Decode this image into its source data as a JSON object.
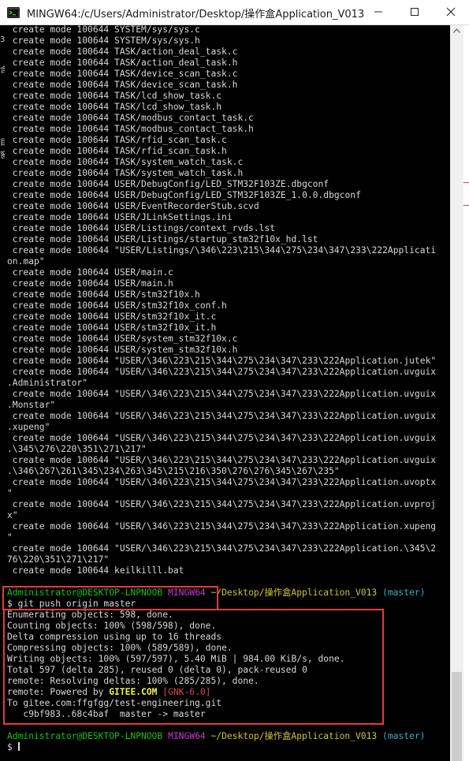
{
  "window": {
    "title": "MINGW64:/c/Users/Administrator/Desktop/操作盒Application_V013",
    "controls": [
      "minimize",
      "maximize",
      "close"
    ]
  },
  "terminal": {
    "lines": [
      " create mode 100644 SYSTEM/sys/sys.c",
      " create mode 100644 SYSTEM/sys/sys.h",
      " create mode 100644 TASK/action_deal_task.c",
      " create mode 100644 TASK/action_deal_task.h",
      " create mode 100644 TASK/device_scan_task.c",
      " create mode 100644 TASK/device_scan_task.h",
      " create mode 100644 TASK/lcd_show_task.c",
      " create mode 100644 TASK/lcd_show_task.h",
      " create mode 100644 TASK/modbus_contact_task.c",
      " create mode 100644 TASK/modbus_contact_task.h",
      " create mode 100644 TASK/rfid_scan_task.c",
      " create mode 100644 TASK/rfid_scan_task.h",
      " create mode 100644 TASK/system_watch_task.c",
      " create mode 100644 TASK/system_watch_task.h",
      " create mode 100644 USER/DebugConfig/LED_STM32F103ZE.dbgconf",
      " create mode 100644 USER/DebugConfig/LED_STM32F103ZE_1.0.0.dbgconf",
      " create mode 100644 USER/EventRecorderStub.scvd",
      " create mode 100644 USER/JLinkSettings.ini",
      " create mode 100644 USER/Listings/context_rvds.lst",
      " create mode 100644 USER/Listings/startup_stm32f10x_hd.lst",
      " create mode 100644 \"USER/Listings/\\346\\223\\215\\344\\275\\234\\347\\233\\222Applicati",
      "on.map\"",
      " create mode 100644 USER/main.c",
      " create mode 100644 USER/main.h",
      " create mode 100644 USER/stm32f10x.h",
      " create mode 100644 USER/stm32f10x_conf.h",
      " create mode 100644 USER/stm32f10x_it.c",
      " create mode 100644 USER/stm32f10x_it.h",
      " create mode 100644 USER/system_stm32f10x.c",
      " create mode 100644 USER/system_stm32f10x.h",
      " create mode 100644 \"USER/\\346\\223\\215\\344\\275\\234\\347\\233\\222Application.jutek\"",
      " create mode 100644 \"USER/\\346\\223\\215\\344\\275\\234\\347\\233\\222Application.uvguix",
      ".Administrator\"",
      " create mode 100644 \"USER/\\346\\223\\215\\344\\275\\234\\347\\233\\222Application.uvguix",
      ".Monstar\"",
      " create mode 100644 \"USER/\\346\\223\\215\\344\\275\\234\\347\\233\\222Application.uvguix",
      ".xupeng\"",
      " create mode 100644 \"USER/\\346\\223\\215\\344\\275\\234\\347\\233\\222Application.uvguix",
      ".\\345\\276\\220\\351\\271\\217\"",
      " create mode 100644 \"USER/\\346\\223\\215\\344\\275\\234\\347\\233\\222Application.uvguix",
      ".\\346\\267\\261\\345\\234\\263\\345\\215\\216\\350\\276\\276\\345\\267\\235\"",
      " create mode 100644 \"USER/\\346\\223\\215\\344\\275\\234\\347\\233\\222Application.uvoptx",
      "\"",
      " create mode 100644 \"USER/\\346\\223\\215\\344\\275\\234\\347\\233\\222Application.uvproj",
      "x\"",
      " create mode 100644 \"USER/\\346\\223\\215\\344\\275\\234\\347\\233\\222Application.xupeng",
      "\"",
      " create mode 100644 \"USER/\\346\\223\\215\\344\\275\\234\\347\\233\\222Application.\\345\\2",
      "76\\220\\351\\271\\217\"",
      " create mode 100644 keilkilll.bat"
    ],
    "prompt1": {
      "user_host": "Administrator@DESKTOP-LNPNOOB",
      "shell": "MINGW64",
      "path": "~/Desktop/操作盒Application_V013",
      "branch": "(master)"
    },
    "command": "$ git push origin master",
    "push_output": [
      "Enumerating objects: 598, done.",
      "Counting objects: 100% (598/598), done.",
      "Delta compression using up to 16 threads",
      "Compressing objects: 100% (589/589), done.",
      "Writing objects: 100% (597/597), 5.40 MiB | 984.00 KiB/s, done.",
      "Total 597 (delta 285), reused 0 (delta 0), pack-reused 0",
      "remote: Resolving deltas: 100% (285/285), done."
    ],
    "powered": {
      "prefix": "remote: Powered by ",
      "brand": "GITEE.COM",
      "space": " ",
      "version": "[GNK-6.0]"
    },
    "push_tail": [
      "To gitee.com:ffgfgg/test-engineering.git",
      "   c9bf983..68c4baf  master -> master"
    ],
    "prompt2": {
      "user_host": "Administrator@DESKTOP-LNPNOOB",
      "shell": "MINGW64",
      "path": "~/Desktop/操作盒Application_V013",
      "branch": "(master)"
    },
    "final_prompt": "$ "
  },
  "colors": {
    "background": "#000000",
    "text": "#d8d8d8",
    "user_host": "#13c313",
    "shell": "#c93ad1",
    "path": "#c6c639",
    "branch": "#3aaec6",
    "gitee_brand": "#f2f24b",
    "gnk_version": "#d24949",
    "annotation_box": "#e53a3a"
  },
  "left_fragments": [
    "3",
    "含",
    "目",
    "窗"
  ]
}
